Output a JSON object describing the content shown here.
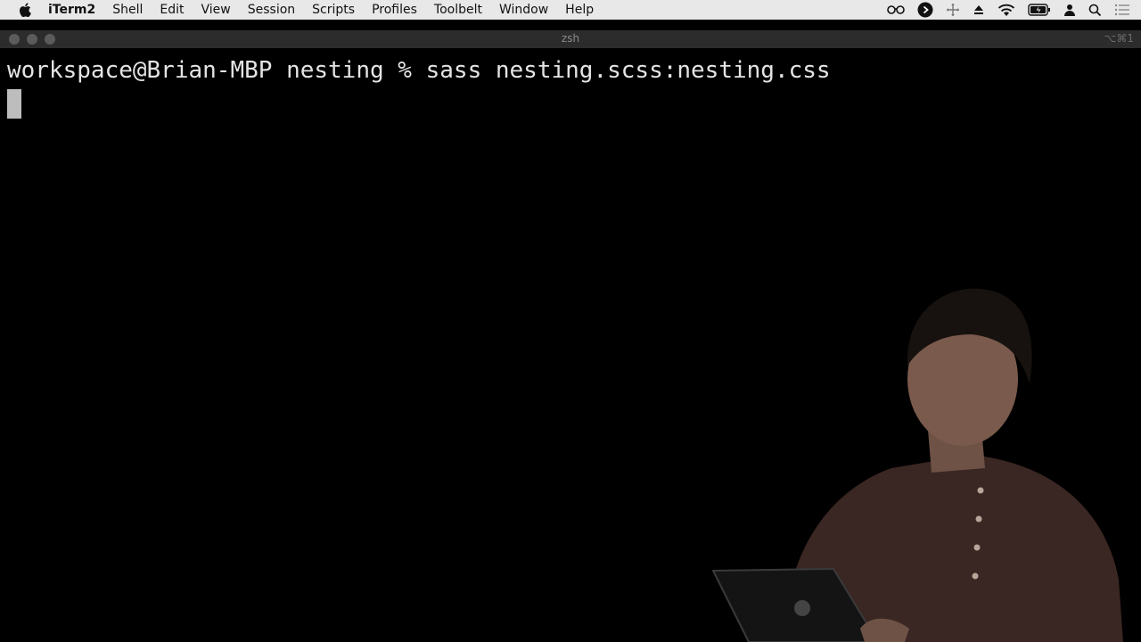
{
  "menubar": {
    "app_name": "iTerm2",
    "items": [
      "Shell",
      "Edit",
      "View",
      "Session",
      "Scripts",
      "Profiles",
      "Toolbelt",
      "Window",
      "Help"
    ],
    "status_icons": [
      "glasses-icon",
      "play-circle-icon",
      "move-icon",
      "eject-icon",
      "wifi-icon",
      "battery-icon",
      "user-icon",
      "search-icon",
      "list-icon"
    ]
  },
  "window": {
    "title": "zsh",
    "shortcut": "⌥⌘1"
  },
  "terminal": {
    "prompt": "workspace@Brian-MBP nesting % ",
    "command": "sass nesting.scss:nesting.css"
  },
  "colors": {
    "menubar_bg": "#e9e8e8",
    "titlebar_bg": "#2c2c2c",
    "terminal_bg": "#000000",
    "terminal_fg": "#e4e4e4"
  }
}
